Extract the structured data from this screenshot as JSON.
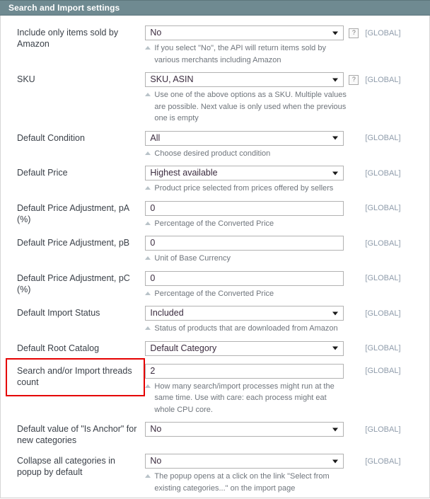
{
  "panel": {
    "title": "Search and Import settings",
    "scope_label": "[GLOBAL]",
    "help_glyph": "?",
    "header_bg": "#6f8a91",
    "highlight_color": "#e50000"
  },
  "rows": [
    {
      "label": "Include only items sold by Amazon",
      "control": "select",
      "value": "No",
      "help": true,
      "scope": "[GLOBAL]",
      "hint": "If you select \"No\", the API will return items sold by various merchants including Amazon"
    },
    {
      "label": "SKU",
      "control": "select",
      "value": "SKU, ASIN",
      "help": true,
      "scope": "[GLOBAL]",
      "hint": "Use one of the above options as a SKU. Multiple values are possible. Next value is only used when the previous one is empty"
    },
    {
      "label": "Default Condition",
      "control": "select",
      "value": "All",
      "help": false,
      "scope": "[GLOBAL]",
      "hint": "Choose desired product condition"
    },
    {
      "label": "Default Price",
      "control": "select",
      "value": "Highest available",
      "help": false,
      "scope": "[GLOBAL]",
      "hint": "Product price selected from prices offered by sellers"
    },
    {
      "label": "Default Price Adjustment, pA (%)",
      "control": "input",
      "value": "0",
      "help": false,
      "scope": "[GLOBAL]",
      "hint": "Percentage of the Converted Price"
    },
    {
      "label": "Default Price Adjustment, pB",
      "control": "input",
      "value": "0",
      "help": false,
      "scope": "[GLOBAL]",
      "hint": "Unit of Base Currency"
    },
    {
      "label": "Default Price Adjustment, pC (%)",
      "control": "input",
      "value": "0",
      "help": false,
      "scope": "[GLOBAL]",
      "hint": "Percentage of the Converted Price"
    },
    {
      "label": "Default Import Status",
      "control": "select",
      "value": "Included",
      "help": false,
      "scope": "[GLOBAL]",
      "hint": "Status of products that are downloaded from Amazon"
    },
    {
      "label": "Default Root Catalog",
      "control": "select",
      "value": "Default Category",
      "help": false,
      "scope": "[GLOBAL]",
      "hint": ""
    },
    {
      "label": "Search and/or Import threads count",
      "control": "input",
      "value": "2",
      "help": false,
      "scope": "[GLOBAL]",
      "hint": "How many search/import processes might run at the same time. Use with care: each process might eat whole CPU core.",
      "highlighted": true
    },
    {
      "label": "Default value of \"Is Anchor\" for new categories",
      "control": "select",
      "value": "No",
      "help": false,
      "scope": "[GLOBAL]",
      "hint": ""
    },
    {
      "label": "Collapse all categories in popup by default",
      "control": "select",
      "value": "No",
      "help": false,
      "scope": "[GLOBAL]",
      "hint": "The popup opens at a click on the link \"Select from existing categories...\" on the import page"
    }
  ]
}
